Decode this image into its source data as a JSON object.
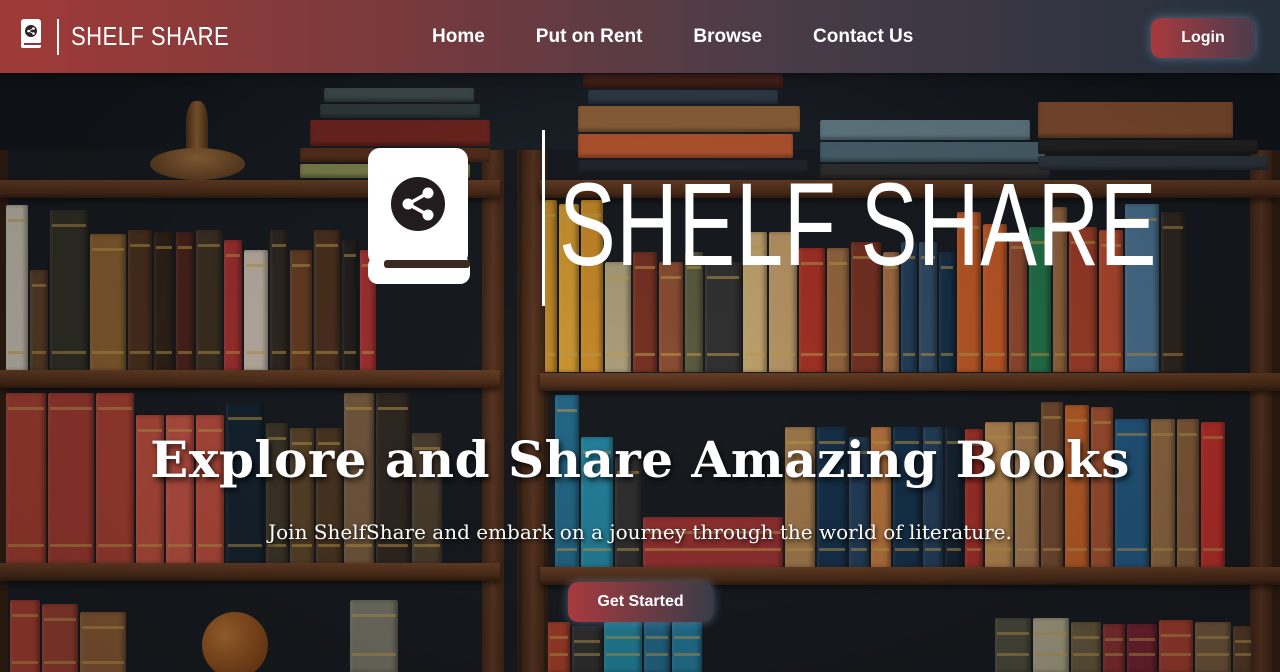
{
  "navbar": {
    "brand_name": "SHELF SHARE",
    "links": [
      {
        "label": "Home"
      },
      {
        "label": "Put on Rent"
      },
      {
        "label": "Browse"
      },
      {
        "label": "Contact Us"
      }
    ],
    "login_label": "Login",
    "icon": "book-share-icon"
  },
  "hero": {
    "logo_name": "SHELF SHARE",
    "logo_icon": "book-share-icon",
    "title": "Explore and Share Amazing Books",
    "subtitle": "Join ShelfShare and embark on a journey through the world of literature.",
    "cta_label": "Get Started"
  },
  "colors": {
    "nav_gradient_start": "#a03a38",
    "nav_gradient_end": "#24303c",
    "button_accent": "#a83a3e",
    "text": "#ffffff"
  }
}
